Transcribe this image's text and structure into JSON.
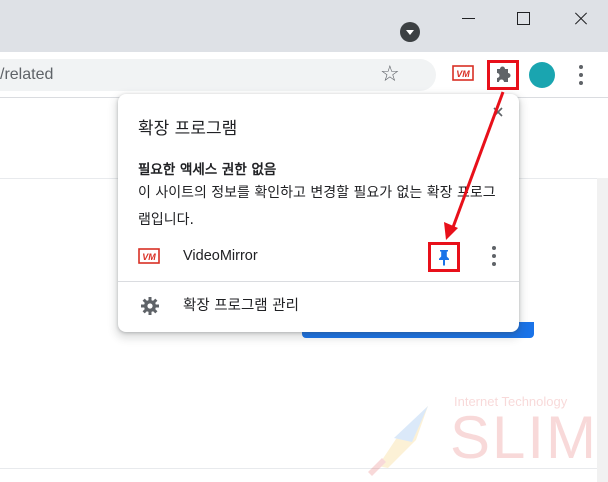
{
  "browser": {
    "tab_search_icon": "chevron-down-circle-icon",
    "window_controls": {
      "minimize": "minimize-icon",
      "maximize": "maximize-icon",
      "close": "close-icon"
    }
  },
  "toolbar": {
    "address_text": "/related",
    "bookmark_icon": "star-icon",
    "videomirror_badge": "VM",
    "extensions_icon": "puzzle-icon",
    "menu_icon": "kebab-menu-icon",
    "avatar_color": "#1aa5b0"
  },
  "popup": {
    "title": "확장 프로그램",
    "section_heading": "필요한 액세스 권한 없음",
    "section_description": "이 사이트의 정보를 확인하고 변경할 필요가 없는 확장 프로그램입니다.",
    "extension": {
      "icon_text": "VM",
      "name": "VideoMirror",
      "pin_icon": "pin-icon",
      "more_icon": "more-vert-icon"
    },
    "manage": {
      "icon": "gear-icon",
      "label": "확장 프로그램 관리"
    }
  },
  "watermark": {
    "subtitle": "Internet Technology",
    "title": "SLIM"
  },
  "colors": {
    "highlight": "#e8101a",
    "pin_blue": "#1a73e8",
    "titlebar": "#dee1e6",
    "vm_red": "#d93025"
  }
}
